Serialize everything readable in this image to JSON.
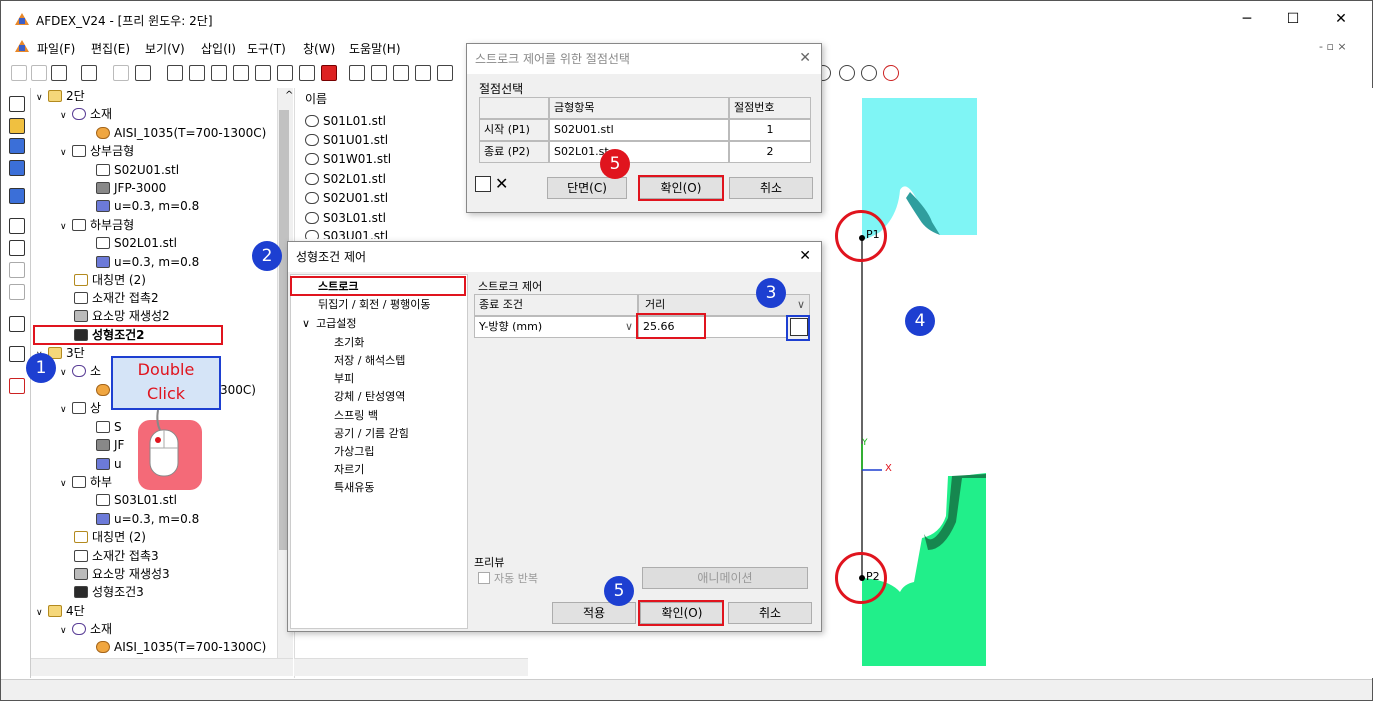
{
  "window": {
    "title": "AFDEX_V24 - [프리 윈도우: 2단]",
    "minimize": "─",
    "maximize": "☐",
    "close": "✕",
    "mdi_buttons": "- ▫ ×"
  },
  "menu": [
    "파일(F)",
    "편집(E)",
    "보기(V)",
    "삽입(I)",
    "도구(T)",
    "창(W)",
    "도움말(H)"
  ],
  "tree": [
    {
      "exp": "∨",
      "label": "2단",
      "icon": "folder"
    },
    {
      "exp": "∨",
      "label": "소재",
      "icon": "billet"
    },
    {
      "exp": "",
      "label": "AISI_1035(T=700-1300C)",
      "icon": "material"
    },
    {
      "exp": "∨",
      "label": "상부금형",
      "icon": "die"
    },
    {
      "exp": "",
      "label": "S02U01.stl",
      "icon": "die"
    },
    {
      "exp": "",
      "label": "JFP-3000",
      "icon": "press"
    },
    {
      "exp": "",
      "label": "u=0.3, m=0.8",
      "icon": "friction"
    },
    {
      "exp": "∨",
      "label": "하부금형",
      "icon": "die"
    },
    {
      "exp": "",
      "label": "S02L01.stl",
      "icon": "die"
    },
    {
      "exp": "",
      "label": "u=0.3, m=0.8",
      "icon": "friction"
    },
    {
      "exp": "",
      "label": "대칭면 (2)",
      "icon": "symmetry"
    },
    {
      "exp": "",
      "label": "소재간 접촉2",
      "icon": "contact"
    },
    {
      "exp": "",
      "label": "요소망 재생성2",
      "icon": "mesh"
    },
    {
      "exp": "",
      "label": "성형조건2",
      "icon": "condition"
    },
    {
      "exp": "∨",
      "label": "3단",
      "icon": "folder"
    },
    {
      "exp": "∨",
      "label": "소",
      "icon": "billet"
    },
    {
      "exp": "",
      "label": "300C)",
      "icon": "material"
    },
    {
      "exp": "∨",
      "label": "상",
      "icon": "die"
    },
    {
      "exp": "",
      "label": "S",
      "icon": "die"
    },
    {
      "exp": "",
      "label": "JF",
      "icon": "press"
    },
    {
      "exp": "",
      "label": "u",
      "icon": "friction"
    },
    {
      "exp": "∨",
      "label": "하부",
      "icon": "die"
    },
    {
      "exp": "",
      "label": "S03L01.stl",
      "icon": "die"
    },
    {
      "exp": "",
      "label": "u=0.3, m=0.8",
      "icon": "friction"
    },
    {
      "exp": "",
      "label": "대칭면 (2)",
      "icon": "symmetry"
    },
    {
      "exp": "",
      "label": "소재간 접촉3",
      "icon": "contact"
    },
    {
      "exp": "",
      "label": "요소망 재생성3",
      "icon": "mesh"
    },
    {
      "exp": "",
      "label": "성형조건3",
      "icon": "condition"
    },
    {
      "exp": "∨",
      "label": "4단",
      "icon": "folder"
    },
    {
      "exp": "∨",
      "label": "소재",
      "icon": "billet"
    },
    {
      "exp": "",
      "label": "AISI_1035(T=700-1300C)",
      "icon": "material"
    }
  ],
  "files": {
    "header": "이름",
    "items": [
      "S01L01.stl",
      "S01U01.stl",
      "S01W01.stl",
      "S02L01.stl",
      "S02U01.stl",
      "S03L01.stl",
      "S03U01.stl"
    ]
  },
  "node_dialog": {
    "title": "스트로크 제어를 위한 절점선택",
    "group": "절점선택",
    "columns": [
      "금형항목",
      "절점번호"
    ],
    "rows": [
      {
        "label": "시작 (P1)",
        "item": "S02U01.stl",
        "node": "1"
      },
      {
        "label": "종료 (P2)",
        "item": "S02L01.st",
        "node": "2"
      }
    ],
    "section_btn": "단면(C)",
    "ok_btn": "확인(O)",
    "cancel_btn": "취소"
  },
  "cond_dialog": {
    "title": "성형조건 제어",
    "nav": [
      {
        "label": "스트로크",
        "indent": 0,
        "exp": ""
      },
      {
        "label": "뒤집기 / 회전 / 평행이동",
        "indent": 0,
        "exp": ""
      },
      {
        "label": "고급설정",
        "indent": 0,
        "exp": "∨"
      },
      {
        "label": "초기화",
        "indent": 1,
        "exp": ""
      },
      {
        "label": "저장 / 해석스텝",
        "indent": 1,
        "exp": ""
      },
      {
        "label": "부피",
        "indent": 1,
        "exp": ""
      },
      {
        "label": "강체 / 탄성영역",
        "indent": 1,
        "exp": ""
      },
      {
        "label": "스프링 백",
        "indent": 1,
        "exp": ""
      },
      {
        "label": "공기 / 기름 갇힘",
        "indent": 1,
        "exp": ""
      },
      {
        "label": "가상그립",
        "indent": 1,
        "exp": ""
      },
      {
        "label": "자르기",
        "indent": 1,
        "exp": ""
      },
      {
        "label": "특새유동",
        "indent": 1,
        "exp": ""
      }
    ],
    "stroke_group": "스트로크 제어",
    "end_condition_label": "종료 조건",
    "end_condition_value": "거리",
    "direction_value": "Y-방향 (mm)",
    "distance_value": "25.66",
    "preview_group": "프리뷰",
    "auto_repeat": "자동 반복",
    "animation_btn": "애니메이션",
    "apply_btn": "적용",
    "ok_btn": "확인(O)",
    "cancel_btn": "취소"
  },
  "annotations": {
    "b1": "1",
    "b2": "2",
    "b3": "3",
    "b4": "4",
    "b5a": "5",
    "b5b": "5",
    "double_click": [
      "Double",
      "Click"
    ],
    "p1": "P1",
    "p2": "P2",
    "axis_x": "X",
    "axis_y": "Y"
  },
  "colors": {
    "upper_die": "#7ff5f5",
    "lower_die": "#21ef8a",
    "highlight": "#e0141e",
    "badge_blue": "#1d3fd1"
  }
}
